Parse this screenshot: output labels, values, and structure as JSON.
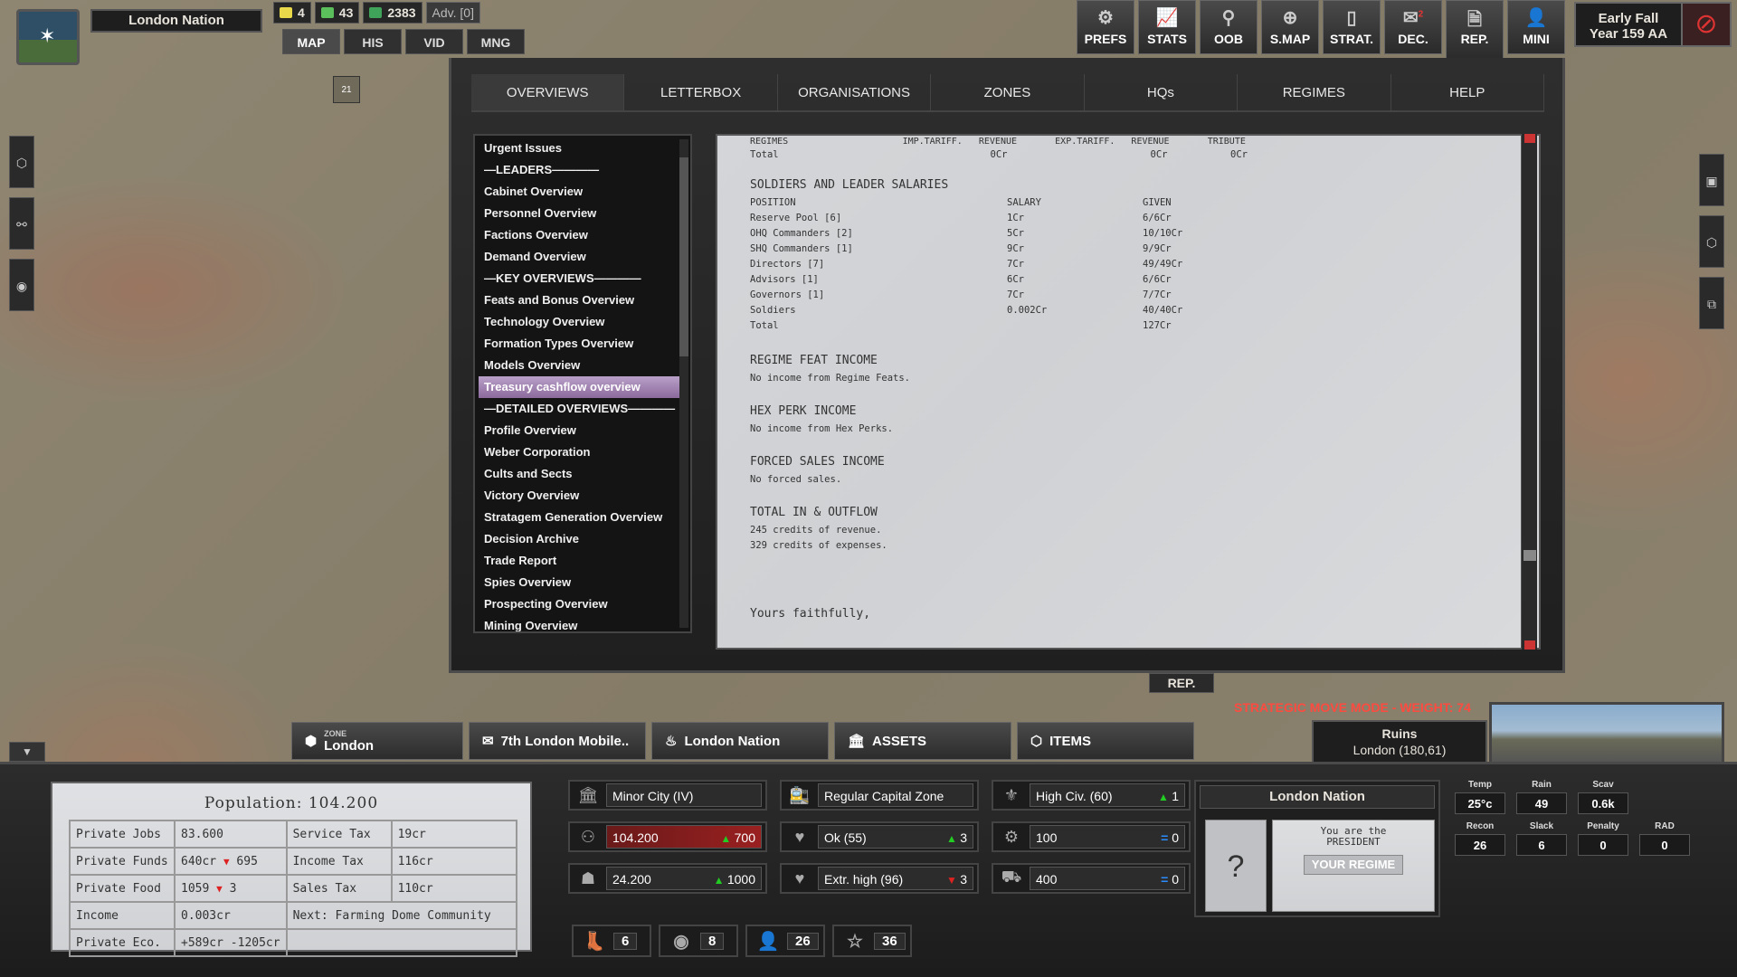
{
  "topbar": {
    "nation": "London Nation",
    "resources": [
      {
        "icon": "sun-icon",
        "value": "4"
      },
      {
        "icon": "fist-icon",
        "value": "43"
      },
      {
        "icon": "credits-icon",
        "value": "2383"
      }
    ],
    "adv": "Adv. [0]",
    "modes": [
      "MAP",
      "HIS",
      "VID",
      "MNG"
    ],
    "tools": [
      {
        "label": "PREFS",
        "icon": "gear-icon"
      },
      {
        "label": "STATS",
        "icon": "chart-icon"
      },
      {
        "label": "OOB",
        "icon": "hierarchy-icon"
      },
      {
        "label": "S.MAP",
        "icon": "globe-icon"
      },
      {
        "label": "STRAT.",
        "icon": "cards-icon"
      },
      {
        "label": "DEC.",
        "icon": "mail-icon",
        "badge": "2"
      },
      {
        "label": "REP.",
        "icon": "report-icon"
      },
      {
        "label": "MINI",
        "icon": "person-icon"
      }
    ],
    "date_line1": "Early Fall",
    "date_line2": "Year 159 AA",
    "unit_marker": "21"
  },
  "report": {
    "tabs": [
      "OVERVIEWS",
      "LETTERBOX",
      "ORGANISATIONS",
      "ZONES",
      "HQs",
      "REGIMES",
      "HELP"
    ],
    "menu": [
      "Urgent Issues",
      "—LEADERS————",
      "Cabinet Overview",
      "Personnel Overview",
      "Factions Overview",
      "Demand Overview",
      "—KEY OVERVIEWS————",
      "Feats and Bonus Overview",
      "Technology Overview",
      "Formation Types Overview",
      "Models Overview",
      "Treasury cashflow overview",
      "—DETAILED OVERVIEWS————",
      "Profile Overview",
      "Weber Corporation",
      "Cults and Sects",
      "Victory Overview",
      "Stratagem Generation Overview",
      "Decision Archive",
      "Trade Report",
      "Spies Overview",
      "Prospecting Overview",
      "Mining Overview"
    ],
    "selected_menu": "Treasury cashflow overview",
    "regimes_header": "REGIMES                     IMP.TARIFF.   REVENUE       EXP.TARIFF.   REVENUE       TRIBUTE",
    "regimes_total": "Total                                     0Cr                         0Cr           0Cr",
    "salaries_title": "SOLDIERS AND LEADER SALARIES",
    "salaries_head": [
      "POSITION",
      "SALARY",
      "GIVEN"
    ],
    "salaries": [
      [
        "Reserve Pool [6]",
        "1Cr",
        "6/6Cr"
      ],
      [
        "OHQ Commanders [2]",
        "5Cr",
        "10/10Cr"
      ],
      [
        "SHQ Commanders [1]",
        "9Cr",
        "9/9Cr"
      ],
      [
        "Directors [7]",
        "7Cr",
        "49/49Cr"
      ],
      [
        "Advisors [1]",
        "6Cr",
        "6/6Cr"
      ],
      [
        "Governors [1]",
        "7Cr",
        "7/7Cr"
      ],
      [
        "Soldiers",
        "0.002Cr",
        "40/40Cr"
      ],
      [
        "Total",
        "",
        "127Cr"
      ]
    ],
    "feat_title": "REGIME FEAT INCOME",
    "feat_text": "No income from Regime Feats.",
    "perk_title": "HEX PERK INCOME",
    "perk_text": "No income from Hex Perks.",
    "forced_title": "FORCED SALES INCOME",
    "forced_text": "No forced sales.",
    "total_title": "TOTAL IN & OUTFLOW",
    "total_rev": "245 credits of revenue.",
    "total_exp": "329 credits of expenses.",
    "closing": "Yours faithfully,",
    "rep_label": "REP."
  },
  "bottom": {
    "strategic": "STRATEGIC MOVE MODE - WEIGHT: 74",
    "tabs": [
      {
        "small": "ZONE",
        "label": "London",
        "icon": "hex-icon"
      },
      {
        "label": "7th London Mobile..",
        "icon": "envelope-icon"
      },
      {
        "label": "London Nation",
        "icon": "flame-icon"
      },
      {
        "label": "ASSETS",
        "icon": "building-icon"
      },
      {
        "label": "ITEMS",
        "icon": "box-icon"
      }
    ],
    "location_name": "Ruins",
    "location_coords": "London (180,61)",
    "population": {
      "title": "Population: 104.200",
      "rows": [
        [
          "Private Jobs",
          "83.600",
          "Service Tax",
          "19cr"
        ],
        [
          "Private Funds",
          "640cr",
          "Income Tax",
          "116cr"
        ],
        [
          "Private Food",
          "1059",
          "Sales Tax",
          "110cr"
        ],
        [
          "Income",
          "0.003cr",
          "Next: Farming Dome Community",
          ""
        ],
        [
          "Private Eco.",
          "+589cr -1205cr",
          "",
          ""
        ]
      ],
      "funds_delta": "695",
      "food_delta": "3"
    },
    "stats": [
      {
        "icon": "city-icon",
        "label": "Minor City (IV)",
        "delta": "",
        "dir": ""
      },
      {
        "icon": "train-icon",
        "label": "Regular Capital Zone",
        "delta": "",
        "dir": ""
      },
      {
        "icon": "wings-icon",
        "label": "High Civ. (60)",
        "delta": "1",
        "dir": "up"
      },
      {
        "icon": "population-icon",
        "label": "104.200",
        "delta": "700",
        "dir": "up",
        "red": true
      },
      {
        "icon": "heart-icon",
        "label": "Ok (55)",
        "delta": "3",
        "dir": "up"
      },
      {
        "icon": "gear-shield-icon",
        "label": "100",
        "delta": "0",
        "dir": "eq"
      },
      {
        "icon": "worker-icon",
        "label": "24.200",
        "delta": "1000",
        "dir": "up"
      },
      {
        "icon": "heart-icon",
        "label": "Extr. high (96)",
        "delta": "3",
        "dir": "dn"
      },
      {
        "icon": "road-icon",
        "label": "400",
        "delta": "0",
        "dir": "eq"
      }
    ],
    "units": [
      {
        "icon": "boot-icon",
        "value": "6"
      },
      {
        "icon": "eye-icon",
        "value": "8"
      },
      {
        "icon": "leader-icon",
        "value": "26"
      },
      {
        "icon": "star-icon",
        "value": "36"
      }
    ],
    "regime": {
      "title": "London Nation",
      "line1": "You are the",
      "line2": "PRESIDENT",
      "button": "YOUR REGIME"
    },
    "weather": [
      {
        "label": "Temp",
        "value": "25°c"
      },
      {
        "label": "Rain",
        "value": "49"
      },
      {
        "label": "Scav",
        "value": "0.6k"
      },
      {
        "label": "",
        "value": ""
      },
      {
        "label": "Recon",
        "value": "26"
      },
      {
        "label": "Slack",
        "value": "6"
      },
      {
        "label": "Penalty",
        "value": "0"
      },
      {
        "label": "RAD",
        "value": "0"
      }
    ]
  }
}
